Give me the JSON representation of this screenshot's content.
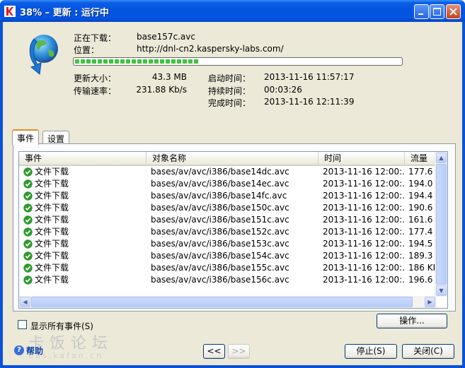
{
  "window": {
    "title": "38% – 更新 : 运行中"
  },
  "download": {
    "downloading_label": "正在下载：",
    "downloading_value": "base157c.avc",
    "location_label": "位置：",
    "location_value": "http://dnl-cn2.kaspersky-labs.com/",
    "progress_percent": 38
  },
  "stats": {
    "size_label": "更新大小：",
    "size_value": "43.3 MB",
    "rate_label": "传输速率：",
    "rate_value": "231.88 Kb/s",
    "start_label": "启动时间：",
    "start_value": "2013-11-16 11:57:17",
    "duration_label": "持续时间：",
    "duration_value": "00:03:26",
    "finish_label": "完成时间：",
    "finish_value": "2013-11-16 12:11:39"
  },
  "tabs": [
    {
      "label": "事件"
    },
    {
      "label": "设置"
    }
  ],
  "events": {
    "columns": [
      "事件",
      "对象名称",
      "时间",
      "流量"
    ],
    "rows": [
      {
        "event": "文件下载",
        "object": "bases/av/avc/i386/base14dc.avc",
        "time": "2013-11-16 12:00:...",
        "traffic": "177.6 K"
      },
      {
        "event": "文件下载",
        "object": "bases/av/avc/i386/base14ec.avc",
        "time": "2013-11-16 12:00:...",
        "traffic": "194.0 K"
      },
      {
        "event": "文件下载",
        "object": "bases/av/avc/i386/base14fc.avc",
        "time": "2013-11-16 12:00:...",
        "traffic": "194.4 K"
      },
      {
        "event": "文件下载",
        "object": "bases/av/avc/i386/base150c.avc",
        "time": "2013-11-16 12:00:...",
        "traffic": "190.6 K"
      },
      {
        "event": "文件下载",
        "object": "bases/av/avc/i386/base151c.avc",
        "time": "2013-11-16 12:00:...",
        "traffic": "161.6 K"
      },
      {
        "event": "文件下载",
        "object": "bases/av/avc/i386/base152c.avc",
        "time": "2013-11-16 12:00:...",
        "traffic": "177.4 K"
      },
      {
        "event": "文件下载",
        "object": "bases/av/avc/i386/base153c.avc",
        "time": "2013-11-16 12:00:...",
        "traffic": "194.5 K"
      },
      {
        "event": "文件下载",
        "object": "bases/av/avc/i386/base154c.avc",
        "time": "2013-11-16 12:00:...",
        "traffic": "189.3 K"
      },
      {
        "event": "文件下载",
        "object": "bases/av/avc/i386/base155c.avc",
        "time": "2013-11-16 12:00:...",
        "traffic": "186 KB"
      },
      {
        "event": "文件下载",
        "object": "bases/av/avc/i386/base156c.avc",
        "time": "2013-11-16 12:00:...",
        "traffic": "196.6 K"
      }
    ]
  },
  "controls": {
    "show_all_events_label": "显示所有事件(S)",
    "actions_button": "操作...",
    "help_link": "帮助",
    "prev_button": "<<",
    "next_button": ">>",
    "stop_button": "停止(S)",
    "close_button": "关闭(C)"
  },
  "watermark": {
    "main": "卡饭论坛",
    "url": "bbs.kafan.cn"
  },
  "colors": {
    "titlebar": "#0553df",
    "progress_fill": "#3fc43f",
    "ok_icon": "#2f9a2f"
  }
}
